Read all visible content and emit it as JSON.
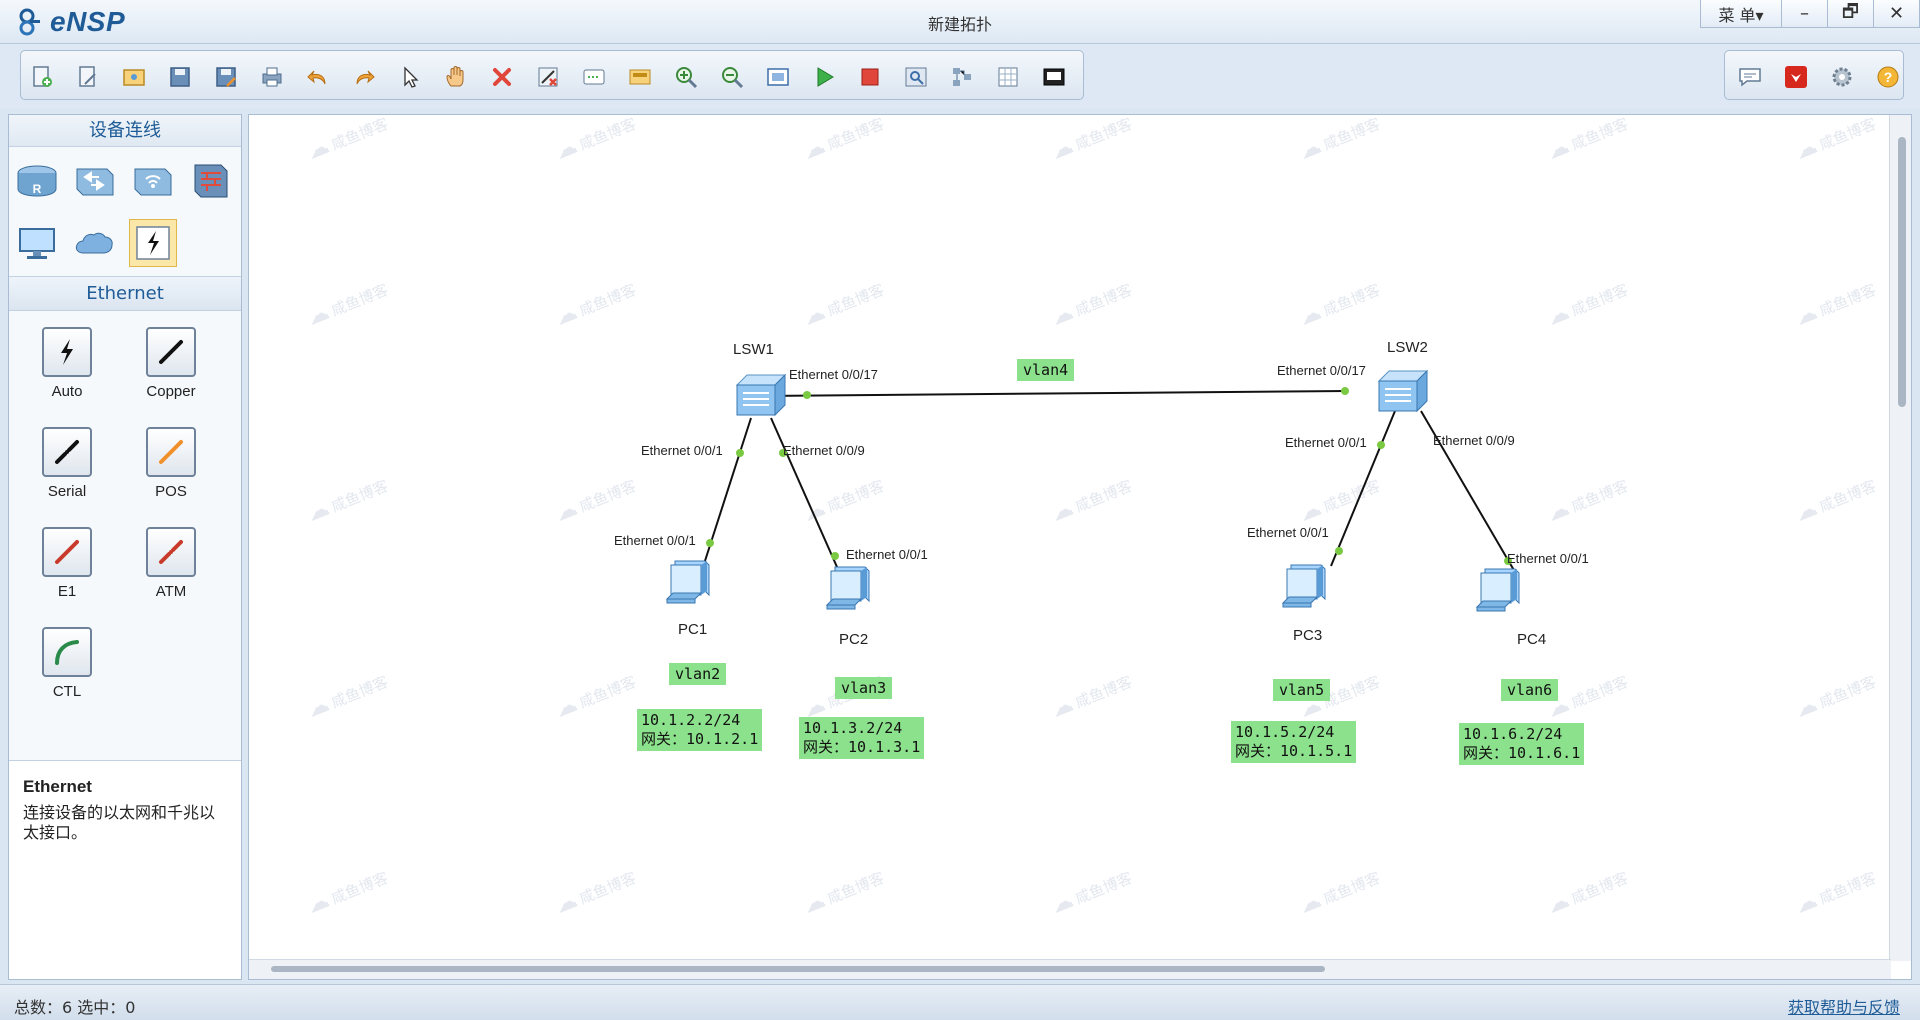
{
  "app": {
    "logo_text": "eNSP",
    "window_title": "新建拓扑",
    "menu_label": "菜 单▾",
    "minimize": "–",
    "restore": "🗗",
    "close": "✕"
  },
  "toolbar": {
    "left": [
      "new-topology-icon",
      "new-example-icon",
      "open-icon",
      "save-icon",
      "save-as-icon",
      "print-icon",
      "undo-icon",
      "redo-icon",
      "select-icon",
      "pan-icon",
      "delete-icon",
      "delete-link-icon",
      "text-icon",
      "palette-icon",
      "zoom-in-icon",
      "zoom-out-icon",
      "fit-icon",
      "start-device-icon",
      "stop-device-icon",
      "capture-icon",
      "topology-icon",
      "grid-icon",
      "screenshot-icon"
    ],
    "right": [
      "chat-icon",
      "huawei-icon",
      "settings-icon",
      "help-icon"
    ]
  },
  "left_panel": {
    "device_header": "设备连线",
    "devices": [
      "router-icon",
      "switch-icon",
      "wireless-icon",
      "firewall-icon",
      "pc-icon",
      "cloud-icon",
      "cable-icon"
    ],
    "cable_header": "Ethernet",
    "cables": [
      {
        "label": "Auto",
        "icon": "auto-cable-icon",
        "color": "#111111"
      },
      {
        "label": "Copper",
        "icon": "copper-cable-icon",
        "color": "#111111"
      },
      {
        "label": "Serial",
        "icon": "serial-cable-icon",
        "color": "#111111"
      },
      {
        "label": "POS",
        "icon": "pos-cable-icon",
        "color": "#f0902a"
      },
      {
        "label": "E1",
        "icon": "e1-cable-icon",
        "color": "#c83a2a"
      },
      {
        "label": "ATM",
        "icon": "atm-cable-icon",
        "color": "#c83a2a"
      },
      {
        "label": "CTL",
        "icon": "ctl-cable-icon",
        "color": "#2a8a4a"
      }
    ],
    "desc_title": "Ethernet",
    "desc_text": "连接设备的以太网和千兆以太接口。"
  },
  "topology": {
    "nodes": {
      "lsw1": "LSW1",
      "lsw2": "LSW2",
      "pc1": "PC1",
      "pc2": "PC2",
      "pc3": "PC3",
      "pc4": "PC4"
    },
    "ports": {
      "lsw1_e17": "Ethernet 0/0/17",
      "lsw1_e1": "Ethernet 0/0/1",
      "lsw1_e9": "Ethernet 0/0/9",
      "pc1_e1": "Ethernet 0/0/1",
      "pc2_e1": "Ethernet 0/0/1",
      "lsw2_e17": "Ethernet 0/0/17",
      "lsw2_e1": "Ethernet 0/0/1",
      "lsw2_e9": "Ethernet 0/0/9",
      "pc3_e1": "Ethernet 0/0/1",
      "pc4_e1": "Ethernet 0/0/1"
    },
    "tags": {
      "vlan4": "vlan4",
      "vlan2": "vlan2",
      "vlan3": "vlan3",
      "vlan5": "vlan5",
      "vlan6": "vlan6"
    },
    "ip": {
      "pc1_ip": "10.1.2.2/24",
      "pc1_gw": "网关：10.1.2.1",
      "pc2_ip": "10.1.3.2/24",
      "pc2_gw": "网关：10.1.3.1",
      "pc3_ip": "10.1.5.2/24",
      "pc3_gw": "网关：10.1.5.1",
      "pc4_ip": "10.1.6.2/24",
      "pc4_gw": "网关：10.1.6.1"
    },
    "watermark": "咸鱼博客",
    "colors": {
      "tag_bg": "#8ce28c",
      "port_dot": "#7ac943",
      "link": "#111111"
    }
  },
  "status": {
    "left": "总数：6  选中：0",
    "right": "获取帮助与反馈"
  }
}
